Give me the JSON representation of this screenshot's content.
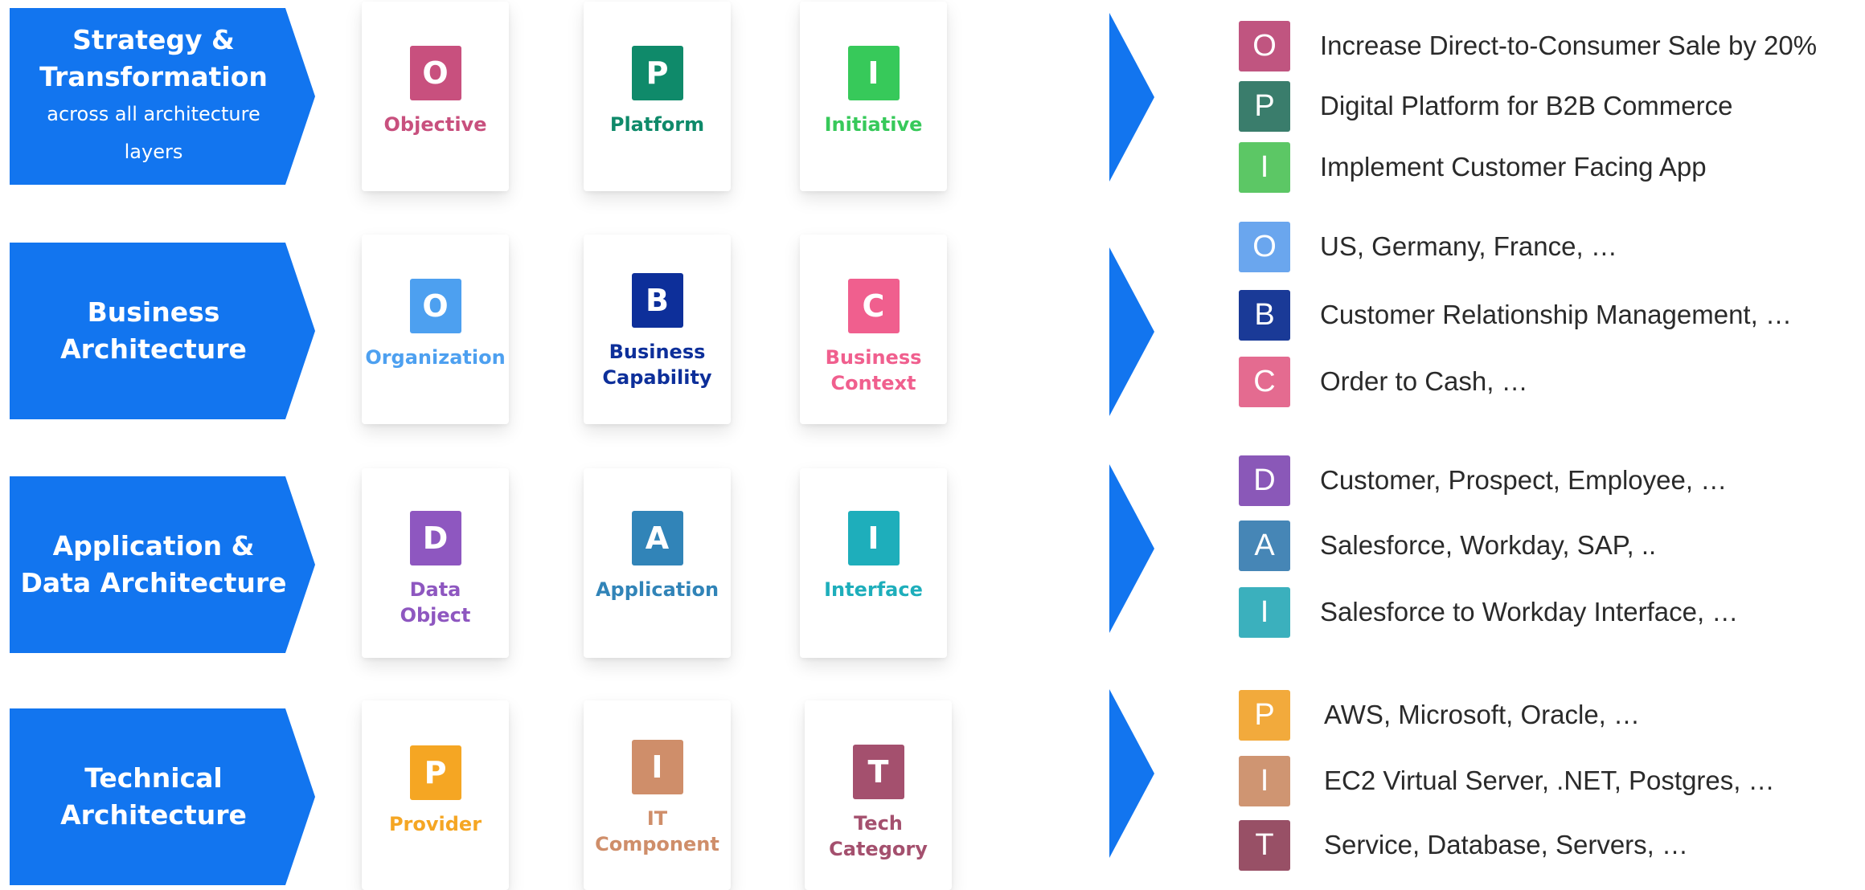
{
  "layers": [
    {
      "id": "strategy",
      "title": "Strategy &\nTransformation",
      "subtitle": "across all architecture layers",
      "cards": [
        {
          "letter": "O",
          "label": "Objective",
          "color": "#c8507e"
        },
        {
          "letter": "P",
          "label": "Platform",
          "color": "#0f8a6a"
        },
        {
          "letter": "I",
          "label": "Initiative",
          "color": "#37c95a"
        }
      ],
      "legend": [
        {
          "letter": "O",
          "text": "Increase Direct-to-Consumer Sale by 20%",
          "color": "#c05580"
        },
        {
          "letter": "P",
          "text": "Digital Platform for B2B Commerce",
          "color": "#3a7d6c"
        },
        {
          "letter": "I",
          "text": "Implement Customer Facing App",
          "color": "#5cc765"
        }
      ]
    },
    {
      "id": "business",
      "title": "Business\nArchitecture",
      "subtitle": "",
      "cards": [
        {
          "letter": "O",
          "label": "Organization",
          "color": "#4da0f0"
        },
        {
          "letter": "B",
          "label": "Business\nCapability",
          "color": "#0d2f9a"
        },
        {
          "letter": "C",
          "label": "Business\nContext",
          "color": "#f05f8e"
        }
      ],
      "legend": [
        {
          "letter": "O",
          "text": "US, Germany, France, …",
          "color": "#6aa6ee"
        },
        {
          "letter": "B",
          "text": "Customer Relationship Management, …",
          "color": "#1a3a97"
        },
        {
          "letter": "C",
          "text": "Order to Cash, …",
          "color": "#e46b90"
        }
      ]
    },
    {
      "id": "application",
      "title": "Application &\nData Architecture",
      "subtitle": "",
      "cards": [
        {
          "letter": "D",
          "label": "Data\nObject",
          "color": "#8e57c0"
        },
        {
          "letter": "A",
          "label": "Application",
          "color": "#3184b8"
        },
        {
          "letter": "I",
          "label": "Interface",
          "color": "#1eaebb"
        }
      ],
      "legend": [
        {
          "letter": "D",
          "text": "Customer, Prospect, Employee, …",
          "color": "#8a58b8"
        },
        {
          "letter": "A",
          "text": "Salesforce, Workday, SAP, ..",
          "color": "#4686b6"
        },
        {
          "letter": "I",
          "text": "Salesforce to Workday Interface, …",
          "color": "#3bb0bd"
        }
      ]
    },
    {
      "id": "technical",
      "title": "Technical\nArchitecture",
      "subtitle": "",
      "cards": [
        {
          "letter": "P",
          "label": "Provider",
          "color": "#f5a623"
        },
        {
          "letter": "I",
          "label": "IT\nComponent",
          "color": "#cf8e6a"
        },
        {
          "letter": "T",
          "label": "Tech\nCategory",
          "color": "#a4506e"
        }
      ],
      "legend": [
        {
          "letter": "P",
          "text": "AWS, Microsoft, Oracle, …",
          "color": "#f2aa3c"
        },
        {
          "letter": "I",
          "text": "EC2 Virtual Server, .NET, Postgres, …",
          "color": "#cf9572"
        },
        {
          "letter": "T",
          "text": "Service, Database, Servers, …",
          "color": "#985066"
        }
      ]
    }
  ]
}
